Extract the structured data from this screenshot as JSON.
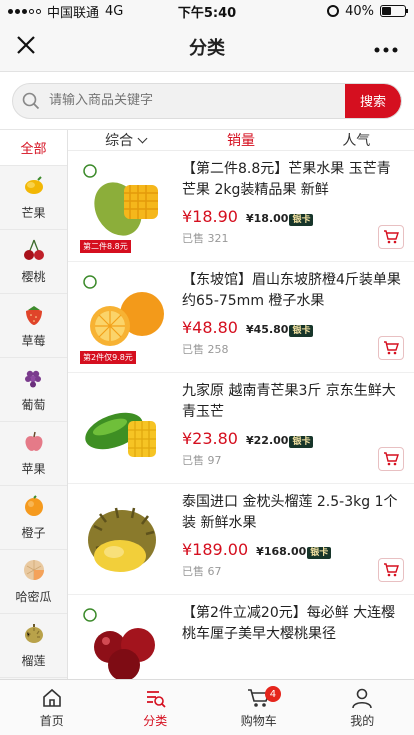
{
  "status_bar": {
    "carrier": "中国联通",
    "network": "4G",
    "time": "下午5:40",
    "battery": "40%"
  },
  "navbar": {
    "title": "分类"
  },
  "search": {
    "placeholder": "请输入商品关键字",
    "button": "搜索"
  },
  "sidebar": {
    "all_label": "全部",
    "items": [
      {
        "label": "芒果",
        "icon": "mango-icon",
        "color": "#f2b705"
      },
      {
        "label": "樱桃",
        "icon": "cherry-icon",
        "color": "#a8111a"
      },
      {
        "label": "草莓",
        "icon": "strawberry-icon",
        "color": "#e0442a"
      },
      {
        "label": "葡萄",
        "icon": "grape-icon",
        "color": "#7a3b8d"
      },
      {
        "label": "苹果",
        "icon": "apple-icon",
        "color": "#e57a88"
      },
      {
        "label": "橙子",
        "icon": "orange-icon",
        "color": "#f59a1e"
      },
      {
        "label": "哈密瓜",
        "icon": "melon-icon",
        "color": "#e9c9a0"
      },
      {
        "label": "榴莲",
        "icon": "durian-icon",
        "color": "#b9a24a"
      }
    ]
  },
  "sort": {
    "comprehensive": "综合",
    "sales": "销量",
    "popularity": "人气"
  },
  "products": [
    {
      "title": "【第二件8.8元】芒果水果 玉芒青芒果 2kg装精品果 新鲜",
      "price": "¥18.90",
      "vip_price": "¥18.00",
      "vip_label": "银卡",
      "sold": "已售 321",
      "image_tag": "第二件8.8元"
    },
    {
      "title": "【东坡馆】眉山东坡脐橙4斤装单果约65-75mm 橙子水果",
      "price": "¥48.80",
      "vip_price": "¥45.80",
      "vip_label": "银卡",
      "sold": "已售 258",
      "image_tag": "第2件仅9.8元"
    },
    {
      "title": "九家原 越南青芒果3斤 京东生鲜大青玉芒",
      "price": "¥23.80",
      "vip_price": "¥22.00",
      "vip_label": "银卡",
      "sold": "已售 97"
    },
    {
      "title": "泰国进口 金枕头榴莲 2.5-3kg 1个装 新鲜水果",
      "price": "¥189.00",
      "vip_price": "¥168.00",
      "vip_label": "银卡",
      "sold": "已售 67"
    },
    {
      "title": "【第2件立减20元】每必鲜 大连樱桃车厘子美早大樱桃果径",
      "price": "",
      "vip_price": "",
      "vip_label": "",
      "sold": ""
    }
  ],
  "tabbar": {
    "items": [
      {
        "label": "首页"
      },
      {
        "label": "分类"
      },
      {
        "label": "购物车",
        "badge": "4"
      },
      {
        "label": "我的"
      }
    ]
  },
  "colors": {
    "accent": "#d50f1f"
  }
}
